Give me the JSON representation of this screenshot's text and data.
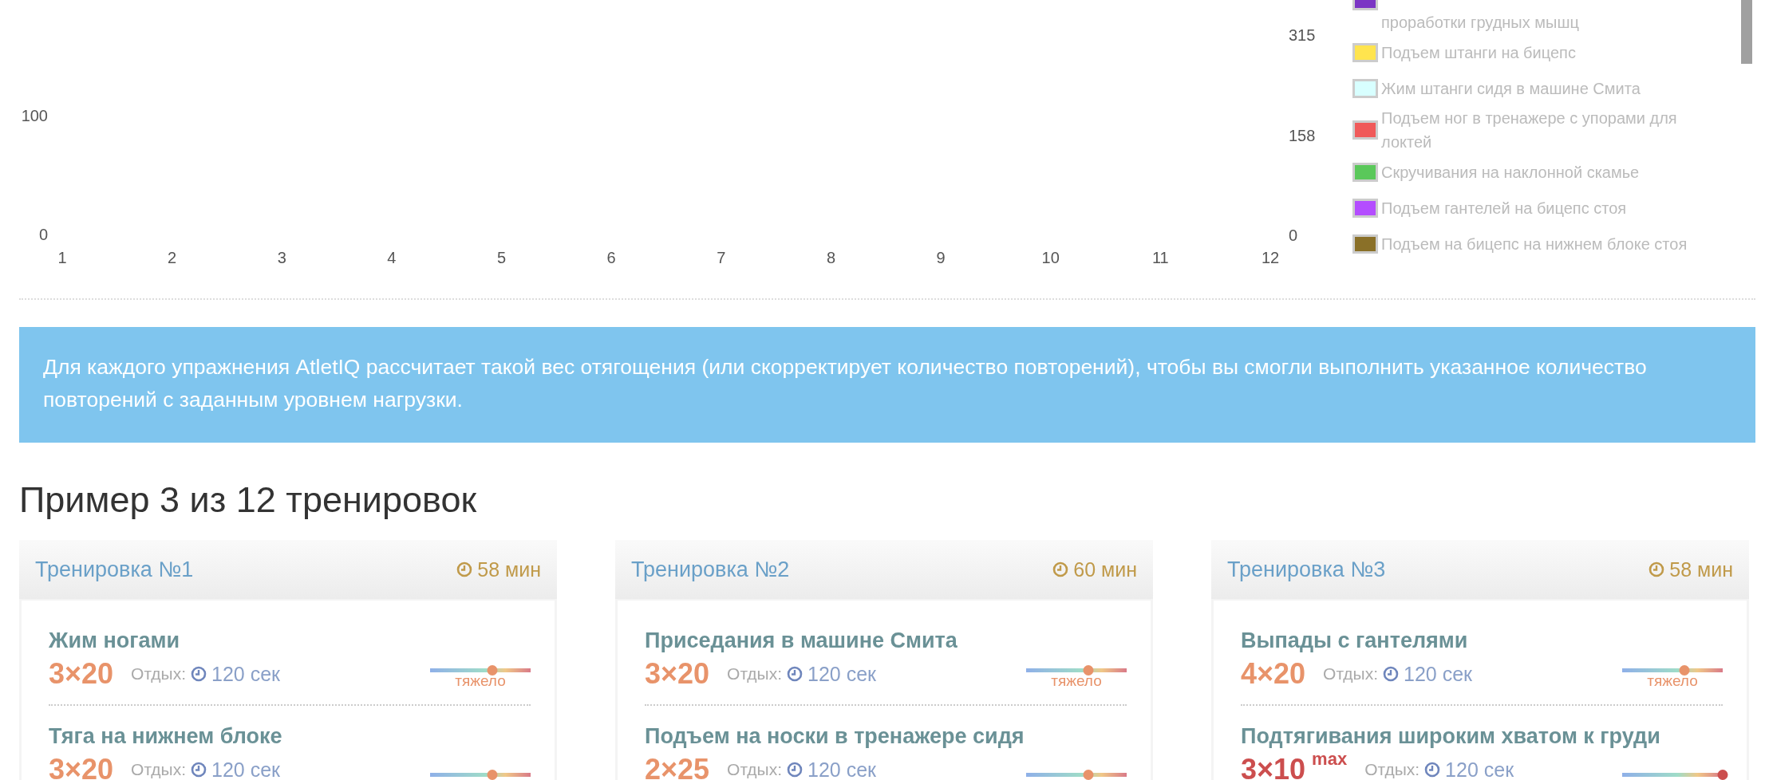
{
  "chart": {
    "left_axis_ticks": [
      "100",
      "0"
    ],
    "x_ticks": [
      "1",
      "2",
      "3",
      "4",
      "5",
      "6",
      "7",
      "8",
      "9",
      "10",
      "11",
      "12"
    ],
    "right_axis_ticks": [
      "315",
      "158",
      "0"
    ],
    "legend": [
      {
        "name": "проработки грудных мышц",
        "color": "#7b35c4"
      },
      {
        "name": "Подъем штанги на бицепс",
        "color": "#ffe44e"
      },
      {
        "name": "Жим штанги сидя в машине Смита",
        "color": "#d8ffff"
      },
      {
        "name": "Подъем ног в тренажере с упорами для локтей",
        "color": "#f05a5a"
      },
      {
        "name": "Скручивания на наклонной скамье",
        "color": "#5ac85a"
      },
      {
        "name": "Подъем гантелей на бицепс стоя",
        "color": "#b44dff"
      },
      {
        "name": "Подъем на бицепс на нижнем блоке стоя",
        "color": "#8a7028"
      }
    ]
  },
  "info": "Для каждого упражнения AtletIQ рассчитает такой вес отягощения (или скорректирует количество повторений), чтобы вы смогли выполнить указанное количество повторений с заданным уровнем нагрузки.",
  "heading": "Пример 3 из 12 тренировок",
  "workouts": [
    {
      "title": "Тренировка №1",
      "duration": "58 мин",
      "exercises": [
        {
          "name": "Жим ногами",
          "sets": "3×20",
          "rest_label": "Отдых:",
          "rest": "120 сек",
          "level": 0.62,
          "intensity": "тяжело"
        },
        {
          "name": "Тяга на нижнем блоке",
          "sets": "3×20",
          "rest_label": "Отдых:",
          "rest": "120 сек",
          "level": 0.62
        }
      ]
    },
    {
      "title": "Тренировка №2",
      "duration": "60 мин",
      "exercises": [
        {
          "name": "Приседания в машине Смита",
          "sets": "3×20",
          "rest_label": "Отдых:",
          "rest": "120 сек",
          "level": 0.62,
          "intensity": "тяжело"
        },
        {
          "name": "Подъем на носки в тренажере сидя",
          "sets": "2×25",
          "rest_label": "Отдых:",
          "rest": "120 сек",
          "level": 0.62
        }
      ]
    },
    {
      "title": "Тренировка №3",
      "duration": "58 мин",
      "exercises": [
        {
          "name": "Выпады с гантелями",
          "sets": "4×20",
          "rest_label": "Отдых:",
          "rest": "120 сек",
          "level": 0.62,
          "intensity": "тяжело"
        },
        {
          "name": "Подтягивания широким хватом к груди",
          "sets": "3×10",
          "sets_note": "max",
          "rest_label": "Отдых:",
          "rest": "120 сек",
          "level": 1
        }
      ]
    }
  ]
}
